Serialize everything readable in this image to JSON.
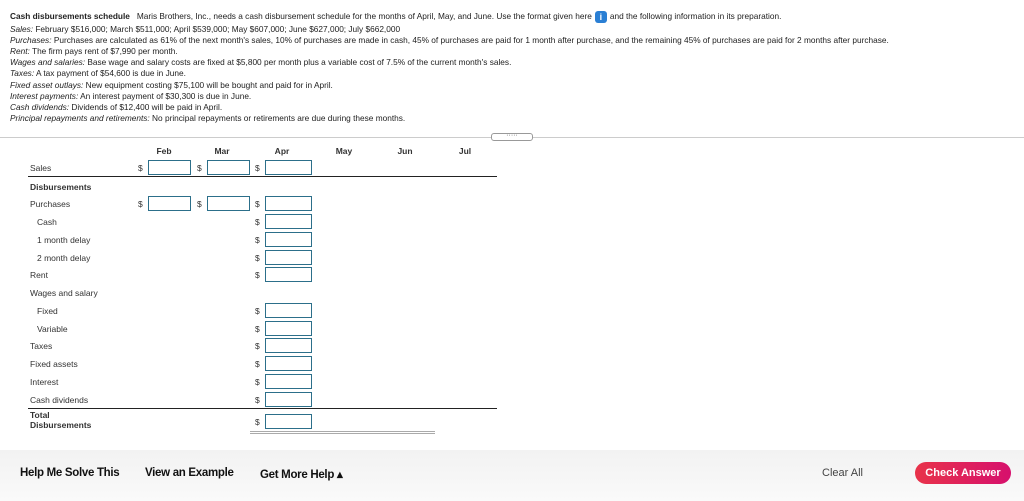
{
  "problem": {
    "title": "Cash disbursements schedule",
    "intro": "Maris Brothers, Inc., needs a cash disbursement schedule for the months of April, May, and June. Use the format given here",
    "intro_end": "and the following information in its preparation.",
    "info_icon": "info-icon",
    "lines": [
      {
        "label": "Sales:",
        "text": " February $516,000; March $511,000; April $539,000; May $607,000; June $627,000; July $662,000"
      },
      {
        "label": "Purchases:",
        "text": " Purchases are calculated as 61% of the next month's sales, 10% of purchases are made in cash, 45% of purchases are paid for 1 month after purchase, and the remaining 45% of purchases are paid for 2 months after purchase."
      },
      {
        "label": "Rent:",
        "text": " The firm pays rent of $7,990 per month."
      },
      {
        "label": "Wages and salaries:",
        "text": " Base wage and salary costs are fixed at $5,800 per month plus a variable cost of 7.5% of the current month's sales."
      },
      {
        "label": "Taxes:",
        "text": " A tax payment of $54,600 is due in June."
      },
      {
        "label": "Fixed asset outlays:",
        "text": " New equipment costing $75,100 will be bought and paid for in April."
      },
      {
        "label": "Interest payments:",
        "text": " An interest payment of $30,300 is due in June."
      },
      {
        "label": "Cash dividends:",
        "text": " Dividends of $12,400 will be paid in April."
      },
      {
        "label": "Principal repayments and retirements:",
        "text": " No principal repayments or retirements are due during these months."
      }
    ]
  },
  "expander": "·····",
  "table": {
    "columns": [
      "Feb",
      "Mar",
      "Apr",
      "May",
      "Jun",
      "Jul"
    ],
    "currency": "$",
    "rows": {
      "sales": "Sales",
      "disbursements": "Disbursements",
      "purchases": "Purchases",
      "cash": "Cash",
      "delay1": "1 month delay",
      "delay2": "2 month delay",
      "rent": "Rent",
      "wages": "Wages and salary",
      "fixed": "Fixed",
      "variable": "Variable",
      "taxes": "Taxes",
      "fixed_assets": "Fixed assets",
      "interest": "Interest",
      "dividends": "Cash dividends",
      "total1": "Total",
      "total2": "Disbursements"
    }
  },
  "footer": {
    "help": "Help Me Solve This",
    "example": "View an Example",
    "more": "Get More Help ▴",
    "clear": "Clear All",
    "check": "Check Answer"
  }
}
